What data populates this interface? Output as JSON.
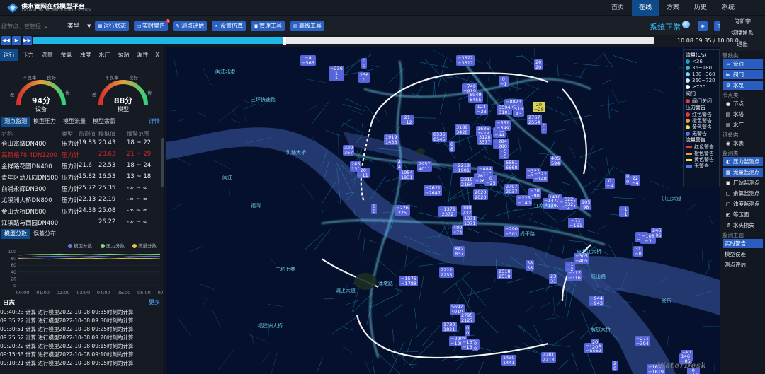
{
  "header": {
    "title": "供水管网在线模型平台",
    "subtitle": "FUZHOU ONLINE WATER SUPPLY SYSTEM",
    "nav": [
      {
        "label": "首页",
        "active": false
      },
      {
        "label": "在线",
        "active": true
      },
      {
        "label": "方案",
        "active": false
      },
      {
        "label": "历史",
        "active": false
      },
      {
        "label": "系统",
        "active": false
      }
    ]
  },
  "toolbar": {
    "search_placeholder": "搜节点、管管径",
    "type_select": "类型",
    "buttons": [
      "运行状态",
      "实时警告",
      "测点评估",
      "设置仿真",
      "管理工具",
      "高级工具"
    ],
    "alert_badge": "1",
    "system_status": "系统正常"
  },
  "right_menu": [
    "何新宇",
    "切换角系",
    "退出"
  ],
  "playbar": {
    "progress": 0.403,
    "time_range": "10 08 09:35 / 10 08 0"
  },
  "left": {
    "tabs": [
      "运行",
      "压力",
      "流量",
      "余氯",
      "浊度",
      "水厂",
      "泵站",
      "漏性"
    ],
    "close": "X",
    "gauges": [
      {
        "score_text": "94分",
        "score": 94,
        "label": "设备",
        "bad": "不良率",
        "good": "良好",
        "poor": "差",
        "excellent": "优"
      },
      {
        "score_text": "88分",
        "score": 88,
        "label": "模型",
        "bad": "不良率",
        "good": "良好",
        "poor": "差",
        "excellent": "优"
      }
    ],
    "subtabs": [
      "测点监测",
      "模型压力",
      "模型流量",
      "模型余氯"
    ],
    "more": "详情",
    "table": {
      "headers": [
        "名称",
        "类型",
        "监测值",
        "模拟值",
        "报警范围"
      ],
      "rows": [
        [
          "仓山富墩DN400",
          "压力计",
          "19.83",
          "20.43",
          "18 ~ 22",
          false
        ],
        [
          "高新格78.4DN1200",
          "压力计",
          "",
          "28.63",
          "21 ~ 29",
          true
        ],
        [
          "金祥路花园DN400",
          "压力计",
          "21.6",
          "22.53",
          "18 ~ 24",
          false
        ],
        [
          "青年区幼儿园DN500",
          "压力计",
          "15.82",
          "16.53",
          "13 ~ 18",
          false
        ],
        [
          "前浦永辉DN300",
          "压力计",
          "25.72",
          "25.35",
          "-∞ ~ ∞",
          false
        ],
        [
          "尤溪洲大桥DN800",
          "压力计",
          "22.13",
          "22.19",
          "-∞ ~ ∞",
          false
        ],
        [
          "金山大桥DN600",
          "压力计",
          "24.38",
          "25.08",
          "-∞ ~ ∞",
          false
        ],
        [
          "江滨路与西园DN400",
          "",
          "",
          "26.22",
          "-∞ ~ ∞",
          false
        ]
      ]
    },
    "chart_tabs": [
      "模型分数",
      "误差分布"
    ],
    "chart_data": {
      "type": "line",
      "categories": [
        "00:00",
        "01:00",
        "02:00",
        "03:00",
        "04:00",
        "05:00",
        "06:00",
        "07:00"
      ],
      "ylim": [
        0,
        100
      ],
      "yticks": [
        "100",
        "80",
        "60",
        "40",
        "20",
        "0"
      ],
      "series": [
        {
          "name": "模型分数",
          "color": "#5b7be0",
          "values": [
            84,
            84,
            86,
            86,
            87,
            86,
            85,
            86,
            87,
            85,
            84,
            86,
            86,
            87,
            86
          ]
        },
        {
          "name": "压力分数",
          "color": "#7ddc7a",
          "values": [
            90,
            91,
            92,
            92,
            93,
            92,
            92,
            91,
            92,
            93,
            92,
            91,
            92,
            92,
            93
          ]
        },
        {
          "name": "流量分数",
          "color": "#e8c24a",
          "values": [
            80,
            79,
            79,
            78,
            79,
            80,
            80,
            81,
            80,
            79,
            80,
            81,
            80,
            80,
            79
          ]
        }
      ]
    },
    "log": {
      "title": "日志",
      "more": "更多",
      "rows": [
        "09:40:23 计算  进行模型2022-10-08 09:35时刻的计算",
        "09:35:22 计算  进行模型2022-10-08 09:30时刻的计算",
        "09:30:51 计算  进行模型2022-10-08 09:25时刻的计算",
        "09:25:52 计算  进行模型2022-10-08 09:20时刻的计算",
        "09:20:22 计算  进行模型2022-10-08 09:15时刻的计算",
        "09:15:53 计算  进行模型2022-10-08 09:10时刻的计算",
        "09:10:21 计算  进行模型2022-10-08 09:05时刻的计算"
      ]
    }
  },
  "legend": {
    "flow_title": "流量(L/s)",
    "flow": [
      {
        "label": "<36",
        "color": "#1f9fbf"
      },
      {
        "label": "36~180",
        "color": "#2bb8e0"
      },
      {
        "label": "180~360",
        "color": "#6fd6ff"
      },
      {
        "label": "360~720",
        "color": "#c9f2ff"
      },
      {
        "label": "≥720",
        "color": "#ffffff"
      }
    ],
    "valve_title": "阀门",
    "valve": [
      {
        "label": "阀门关闭",
        "color": "#e53935"
      }
    ],
    "pressure_title": "压力警告",
    "pressure": [
      {
        "label": "红色警告",
        "color": "#e53935"
      },
      {
        "label": "橙色警告",
        "color": "#f39c33"
      },
      {
        "label": "黄色警告",
        "color": "#f1e24b"
      },
      {
        "label": "无警告",
        "color": "#4a7de0"
      }
    ],
    "flow_alarm_title": "流量警告",
    "flow_alarm": [
      {
        "label": "红色警告",
        "color": "#e53935"
      },
      {
        "label": "橙色警告",
        "color": "#f39c33"
      },
      {
        "label": "黄色警告",
        "color": "#f1e24b"
      },
      {
        "label": "无警告",
        "color": "#4a7de0"
      }
    ]
  },
  "layers": {
    "pipe_title": "管线类",
    "pipe": [
      {
        "label": "管线",
        "icon": "═",
        "on": true
      },
      {
        "label": "阀门",
        "icon": "⋈",
        "on": true
      },
      {
        "label": "水泵",
        "icon": "⚙",
        "on": true
      }
    ],
    "node_title": "节点类",
    "node": [
      {
        "label": "节点",
        "icon": "●",
        "on": false
      },
      {
        "label": "水塔",
        "icon": "▤",
        "on": false
      },
      {
        "label": "水厂",
        "icon": "▥",
        "on": false
      }
    ],
    "equip_title": "设备类",
    "equip": [
      {
        "label": "水表",
        "icon": "◉",
        "on": false
      }
    ],
    "mon_title": "监测类",
    "mon": [
      {
        "label": "压力监测点",
        "icon": "◐",
        "on": true
      },
      {
        "label": "流量监测点",
        "icon": "▦",
        "on": true
      },
      {
        "label": "厂站监测点",
        "icon": "▣",
        "on": false
      },
      {
        "label": "余氯监测点",
        "icon": "▢",
        "on": false
      },
      {
        "label": "浊度监测点",
        "icon": "▢",
        "on": false
      },
      {
        "label": "等压面",
        "icon": "◩",
        "on": false
      },
      {
        "label": "水头损失",
        "icon": "⇵",
        "on": false
      }
    ],
    "analysis_title": "监测主题",
    "analysis": [
      {
        "label": "实时警告",
        "on": true
      },
      {
        "label": "模型误差",
        "on": false
      },
      {
        "label": "测点评估",
        "on": false
      }
    ]
  },
  "map_labels": [
    [
      "−8",
      "−566",
      90,
      8
    ],
    [
      "0",
      "0",
      176,
      12
    ],
    [
      "−3322",
      "−3317",
      310,
      8
    ],
    [
      "−236",
      "1",
      "1",
      130,
      23
    ],
    [
      "20",
      "20",
      420,
      14
    ],
    [
      "236",
      "0",
      172,
      32
    ],
    [
      "−749",
      "−919",
      318,
      48
    ],
    [
      "0",
      "−1",
      370,
      38
    ],
    [
      "6949",
      "6455",
      327,
      60
    ],
    [
      "−8823",
      "−661",
      378,
      70
    ],
    [
      "3594",
      "3101",
      368,
      78
    ],
    [
      "124",
      "−23",
      337,
      77
    ],
    [
      "516",
      "43",
      390,
      80
    ],
    [
      "20",
      "−28",
      418,
      74
    ],
    [
      "21",
      "−12",
      232,
      92
    ],
    [
      "1919",
      "1433",
      208,
      120
    ],
    [
      "3189",
      "3420",
      308,
      106
    ],
    [
      "1686",
      "1573",
      338,
      108
    ],
    [
      "−46",
      "−44",
      362,
      110
    ],
    [
      "2767",
      "2554",
      410,
      92
    ],
    [
      "−551",
      "−549",
      365,
      100
    ],
    [
      "0",
      "0",
      430,
      104
    ],
    [
      "8536",
      "8545",
      276,
      116
    ],
    [
      "3128",
      "3377",
      340,
      120
    ],
    [
      "8",
      "8",
      300,
      130
    ],
    [
      "−284",
      "−280",
      362,
      126
    ],
    [
      "−5",
      "−5",
      370,
      140
    ],
    [
      "329",
      "367",
      150,
      135
    ],
    [
      "285",
      "139",
      160,
      158
    ],
    [
      "20",
      "−11",
      170,
      167
    ],
    [
      "4",
      "4",
      226,
      155
    ],
    [
      "2957",
      "4011",
      255,
      158
    ],
    [
      "1954",
      "1931",
      230,
      170
    ],
    [
      "−2219",
      "−1901",
      305,
      160
    ],
    [
      "−484",
      "−505",
      340,
      165
    ],
    [
      "2219",
      "2164",
      315,
      180
    ],
    [
      "6581",
      "6668",
      378,
      156
    ],
    [
      "−383",
      "−381",
      408,
      168
    ],
    [
      "−322",
      "−148",
      418,
      172
    ],
    [
      "405",
      "594",
      442,
      150
    ],
    [
      "2621",
      "−2640",
      335,
      175
    ],
    [
      "0",
      "−25",
      350,
      178
    ],
    [
      "2797",
      "2037",
      378,
      190
    ],
    [
      "−70",
      "−90",
      412,
      196
    ],
    [
      "0",
      "−4",
      520,
      182
    ],
    [
      "0",
      "0",
      548,
      176
    ],
    [
      "22",
      "−4",
      556,
      178
    ],
    [
      "−2621",
      "−2647",
      264,
      192
    ],
    [
      "2020",
      "2020",
      334,
      198
    ],
    [
      "−225",
      "−140",
      395,
      206
    ],
    [
      "1410",
      "−8",
      439,
      205
    ],
    [
      "−1477",
      "−1397",
      432,
      210
    ],
    [
      "−6",
      "−6",
      467,
      210
    ],
    [
      "−290",
      "−3",
      454,
      212
    ],
    [
      "0",
      "0",
      190,
      218
    ],
    [
      "−226",
      "225",
      223,
      220
    ],
    [
      "−1371",
      "2372",
      285,
      222
    ],
    [
      "100",
      "232",
      317,
      220
    ],
    [
      "1371",
      "1371",
      319,
      235
    ],
    [
      "−71",
      "−161",
      468,
      238
    ],
    [
      "322",
      "332",
      461,
      208
    ],
    [
      "−1",
      "−1",
      540,
      222
    ],
    [
      "105",
      "98",
      485,
      212
    ],
    [
      "246",
      "206",
      585,
      252
    ],
    [
      "−3",
      "−25",
      563,
      258
    ],
    [
      "−290",
      "−301",
      377,
      250
    ],
    [
      "409",
      "474",
      304,
      248
    ],
    [
      "842",
      "837",
      306,
      278
    ],
    [
      "−108",
      "−3",
      570,
      260
    ],
    [
      "31",
      "−0",
      560,
      278
    ],
    [
      "−305",
      "−405",
      476,
      288
    ],
    [
      "−312",
      "−316",
      466,
      312
    ],
    [
      "2518",
      "2518",
      368,
      310
    ],
    [
      "−1575",
      "−1788",
      230,
      320
    ],
    [
      "2222",
      "2255",
      286,
      308
    ],
    [
      "23",
      "31",
      441,
      317
    ],
    [
      "38",
      "38",
      408,
      298
    ],
    [
      "−1",
      "−2",
      464,
      300
    ],
    [
      "5692",
      "4910",
      301,
      360
    ],
    [
      "2795",
      "2127",
      315,
      372
    ],
    [
      "1730",
      "1821",
      290,
      385
    ],
    [
      "0",
      "0",
      322,
      390
    ],
    [
      "−944",
      "−943",
      497,
      348
    ],
    [
      "−2208",
      "−1999",
      300,
      405
    ],
    [
      "−1356",
      "−1338",
      317,
      410
    ],
    [
      "0",
      "0",
      333,
      412
    ],
    [
      "−4656",
      "−5062",
      491,
      415
    ],
    [
      "−271",
      "−394",
      562,
      405
    ],
    [
      "−81",
      "−3",
      627,
      425
    ],
    [
      "1430",
      "1441",
      374,
      432
    ],
    [
      "2281",
      "2213",
      430,
      428
    ],
    [
      "−1632",
      "−1619",
      579,
      445
    ],
    [
      "146",
      "−85",
      625,
      430
    ],
    [
      "0",
      "−11",
      636,
      450
    ],
    [
      "20",
      "20",
      500,
      410
    ],
    [
      "2",
      "0",
      530,
      440
    ]
  ],
  "road_labels": [
    "闽江北港",
    "三环快速路",
    "洪塘大桥",
    "闽江",
    "福湾",
    "三坊七巷",
    "福建洲大桥",
    "浦上大道",
    "潘墩路",
    "江南大道",
    "鸟龙江大桥",
    "解放大桥",
    "长乐",
    "洪山大道",
    "岐山路",
    "尚干路"
  ],
  "watermark": "WaterDesk"
}
